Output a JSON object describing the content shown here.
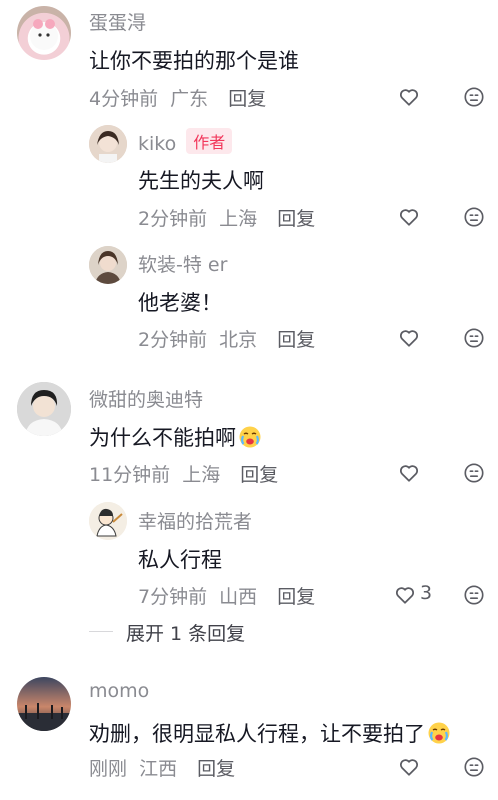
{
  "comments": [
    {
      "username": "蛋蛋淂",
      "text": "让你不要拍的那个是谁",
      "time": "4分钟前",
      "location": "广东",
      "reply_label": "回复",
      "avatar_icon": "pink-cat-avatar",
      "replies": [
        {
          "username": "kiko",
          "badge": "作者",
          "text": "先生的夫人啊",
          "time": "2分钟前",
          "location": "上海",
          "reply_label": "回复",
          "avatar_icon": "girl-avatar"
        },
        {
          "username": "软装-特 er",
          "text": "他老婆！",
          "time": "2分钟前",
          "location": "北京",
          "reply_label": "回复",
          "avatar_icon": "girl-avatar-2"
        }
      ]
    },
    {
      "username": "微甜的奥迪特",
      "text": "为什么不能拍啊",
      "text_emoji": "crying-face-emoji",
      "time": "11分钟前",
      "location": "上海",
      "reply_label": "回复",
      "avatar_icon": "boy-avatar",
      "replies": [
        {
          "username": "幸福的拾荒者",
          "text": "私人行程",
          "time": "7分钟前",
          "location": "山西",
          "reply_label": "回复",
          "like_count": "3",
          "avatar_icon": "cartoon-avatar"
        }
      ],
      "expand_label": "展开 1 条回复"
    },
    {
      "username": "momo",
      "text": "劝删，很明显私人行程，让不要拍了",
      "text_emoji": "crying-face-emoji",
      "time": "刚刚",
      "location": "江西",
      "reply_label": "回复",
      "avatar_icon": "sunset-avatar"
    }
  ],
  "colors": {
    "primary_text": "#161823",
    "secondary_text": "#8a8b91",
    "author_badge": "#f2375b",
    "author_badge_bg": "#fde8ec"
  }
}
